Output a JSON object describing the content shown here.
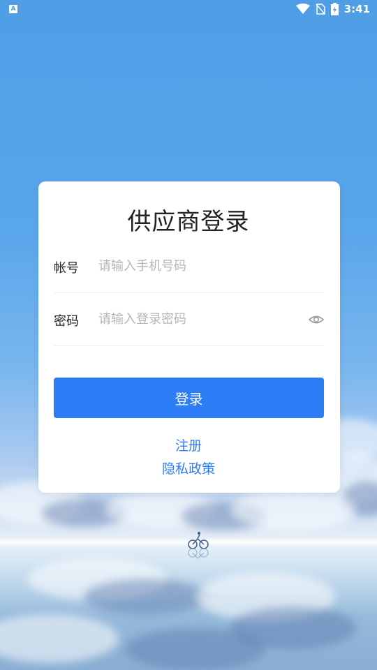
{
  "status_bar": {
    "left_icon_letter": "A",
    "time": "3:41",
    "icons": [
      "wifi-icon",
      "no-sim-icon",
      "battery-charging-icon"
    ]
  },
  "login": {
    "title": "供应商登录",
    "account": {
      "label": "帐号",
      "value": "",
      "placeholder": "请输入手机号码"
    },
    "password": {
      "label": "密码",
      "value": "",
      "placeholder": "请输入登录密码",
      "toggle_icon": "eye-icon"
    },
    "submit_label": "登录",
    "register_link": "注册",
    "privacy_link": "隐私政策"
  },
  "colors": {
    "primary": "#2c7cf6",
    "background_sky": "#4f9ee6",
    "card": "#ffffff"
  }
}
